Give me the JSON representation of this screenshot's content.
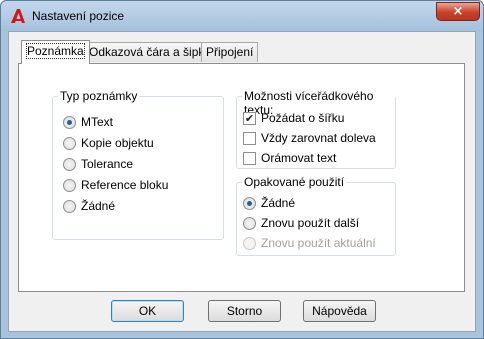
{
  "window": {
    "title": "Nastavení pozice",
    "app_icon": "autocad-a-icon",
    "close_glyph": "×"
  },
  "tabs": [
    {
      "label": "Poznámka",
      "active": true
    },
    {
      "label": "Odkazová čára a šipka",
      "active": false
    },
    {
      "label": "Připojení",
      "active": false
    }
  ],
  "annotation_type": {
    "legend": "Typ poznámky",
    "options": [
      {
        "label": "MText",
        "selected": true
      },
      {
        "label": "Kopie objektu",
        "selected": false
      },
      {
        "label": "Tolerance",
        "selected": false
      },
      {
        "label": "Reference bloku",
        "selected": false
      },
      {
        "label": "Žádné",
        "selected": false
      }
    ]
  },
  "mtext_options": {
    "legend": "Možnosti víceřádkového textu:",
    "options": [
      {
        "label": "Požádat o šířku",
        "checked": true
      },
      {
        "label": "Vždy zarovnat doleva",
        "checked": false
      },
      {
        "label": "Orámovat text",
        "checked": false
      }
    ]
  },
  "reuse": {
    "legend": "Opakované použití",
    "options": [
      {
        "label": "Žádné",
        "selected": true,
        "enabled": true
      },
      {
        "label": "Znovu použít další",
        "selected": false,
        "enabled": true
      },
      {
        "label": "Znovu použít aktuální",
        "selected": false,
        "enabled": false
      }
    ]
  },
  "buttons": {
    "ok": "OK",
    "cancel": "Storno",
    "help": "Nápověda"
  },
  "colors": {
    "title_bar": "#a9c3dd",
    "close_button": "#c9412b",
    "radio_dot": "#2c5d94",
    "default_button_border": "#3c7fb1"
  }
}
